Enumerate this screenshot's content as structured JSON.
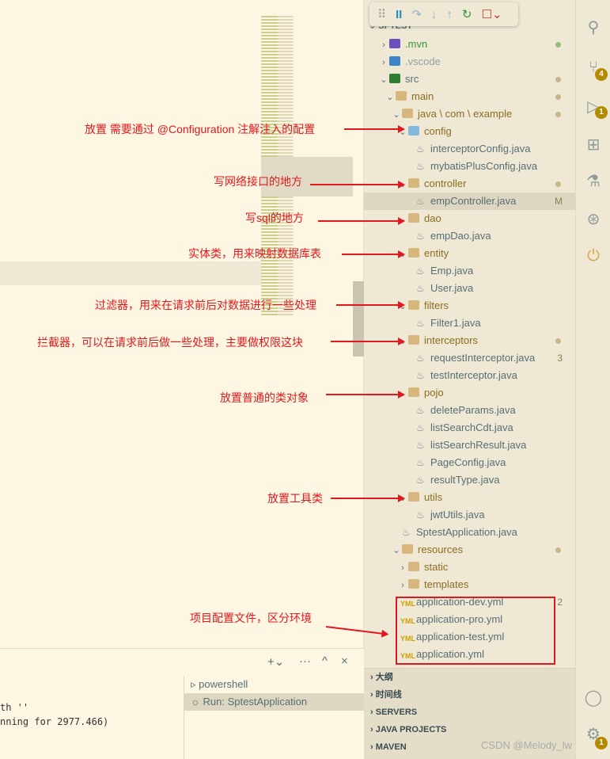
{
  "debug_toolbar": {
    "icons": [
      "drag-handle",
      "pause",
      "step-over",
      "step-into",
      "step-out",
      "restart",
      "stop"
    ]
  },
  "explorer": {
    "section_title": "SPTEST",
    "rows": [
      {
        "label": ".mvn",
        "depth": 0,
        "type": "folder",
        "open": false,
        "status": "green-dot"
      },
      {
        "label": ".vscode",
        "depth": 0,
        "type": "folder",
        "open": false
      },
      {
        "label": "src",
        "depth": 0,
        "type": "folder",
        "open": true,
        "status": "dot"
      },
      {
        "label": "main",
        "depth": 1,
        "type": "folder",
        "open": true,
        "status": "dot"
      },
      {
        "label": "java \\ com \\ example",
        "depth": 2,
        "type": "folder",
        "open": true,
        "status": "dot"
      },
      {
        "label": "config",
        "depth": 3,
        "type": "folder",
        "open": true
      },
      {
        "label": "interceptorConfig.java",
        "depth": 4,
        "type": "java"
      },
      {
        "label": "mybatisPlusConfig.java",
        "depth": 4,
        "type": "java"
      },
      {
        "label": "controller",
        "depth": 3,
        "type": "folder",
        "open": true,
        "status": "dot"
      },
      {
        "label": "empController.java",
        "depth": 4,
        "type": "java",
        "badge": "M",
        "selected": true
      },
      {
        "label": "dao",
        "depth": 3,
        "type": "folder",
        "open": true
      },
      {
        "label": "empDao.java",
        "depth": 4,
        "type": "java"
      },
      {
        "label": "entity",
        "depth": 3,
        "type": "folder",
        "open": true
      },
      {
        "label": "Emp.java",
        "depth": 4,
        "type": "java"
      },
      {
        "label": "User.java",
        "depth": 4,
        "type": "java"
      },
      {
        "label": "filters",
        "depth": 3,
        "type": "folder",
        "open": true
      },
      {
        "label": "Filter1.java",
        "depth": 4,
        "type": "java"
      },
      {
        "label": "interceptors",
        "depth": 3,
        "type": "folder",
        "open": true,
        "status": "dot"
      },
      {
        "label": "requestInterceptor.java",
        "depth": 4,
        "type": "java",
        "badge": "3"
      },
      {
        "label": "testInterceptor.java",
        "depth": 4,
        "type": "java"
      },
      {
        "label": "pojo",
        "depth": 3,
        "type": "folder",
        "open": true
      },
      {
        "label": "deleteParams.java",
        "depth": 4,
        "type": "java"
      },
      {
        "label": "listSearchCdt.java",
        "depth": 4,
        "type": "java"
      },
      {
        "label": "listSearchResult.java",
        "depth": 4,
        "type": "java"
      },
      {
        "label": "PageConfig.java",
        "depth": 4,
        "type": "java"
      },
      {
        "label": "resultType.java",
        "depth": 4,
        "type": "java"
      },
      {
        "label": "utils",
        "depth": 3,
        "type": "folder",
        "open": true
      },
      {
        "label": "jwtUtils.java",
        "depth": 4,
        "type": "java"
      },
      {
        "label": "SptestApplication.java",
        "depth": 3,
        "type": "java"
      },
      {
        "label": "resources",
        "depth": 2,
        "type": "folder",
        "open": true,
        "status": "dot"
      },
      {
        "label": "static",
        "depth": 3,
        "type": "folder",
        "open": false
      },
      {
        "label": "templates",
        "depth": 3,
        "type": "folder",
        "open": false
      },
      {
        "label": "application-dev.yml",
        "depth": 3,
        "type": "yml",
        "badge": "2"
      },
      {
        "label": "application-pro.yml",
        "depth": 3,
        "type": "yml"
      },
      {
        "label": "application-test.yml",
        "depth": 3,
        "type": "yml"
      },
      {
        "label": "application.yml",
        "depth": 3,
        "type": "yml"
      }
    ]
  },
  "bottom_sections": [
    "大纲",
    "时间线",
    "SERVERS",
    "JAVA PROJECTS",
    "MAVEN"
  ],
  "activity_bar": {
    "scm_badge": "4",
    "debug_badge": "1",
    "settings_badge": "1"
  },
  "panel": {
    "terminal_lines": [
      "th ''",
      "nning for 2977.466)"
    ],
    "terminals": [
      {
        "label": "powershell"
      },
      {
        "label": "Run: SptestApplication",
        "selected": true
      }
    ]
  },
  "annotations": [
    "放置 需要通过 @Configuration 注解注入的配置",
    "写网络接口的地方",
    "写sql的地方",
    "实体类，用来映射数据库表",
    "过滤器，用来在请求前后对数据进行一些处理",
    "拦截器，可以在请求前后做一些处理，主要做权限这块",
    "放置普通的类对象",
    "放置工具类",
    "项目配置文件，区分环境"
  ],
  "watermark": "CSDN @Melody_lw",
  "colors": {
    "annotation": "#e0191e",
    "badge": "#b58900",
    "background": "#fdf6e3",
    "sidebar": "#eee8d5"
  }
}
